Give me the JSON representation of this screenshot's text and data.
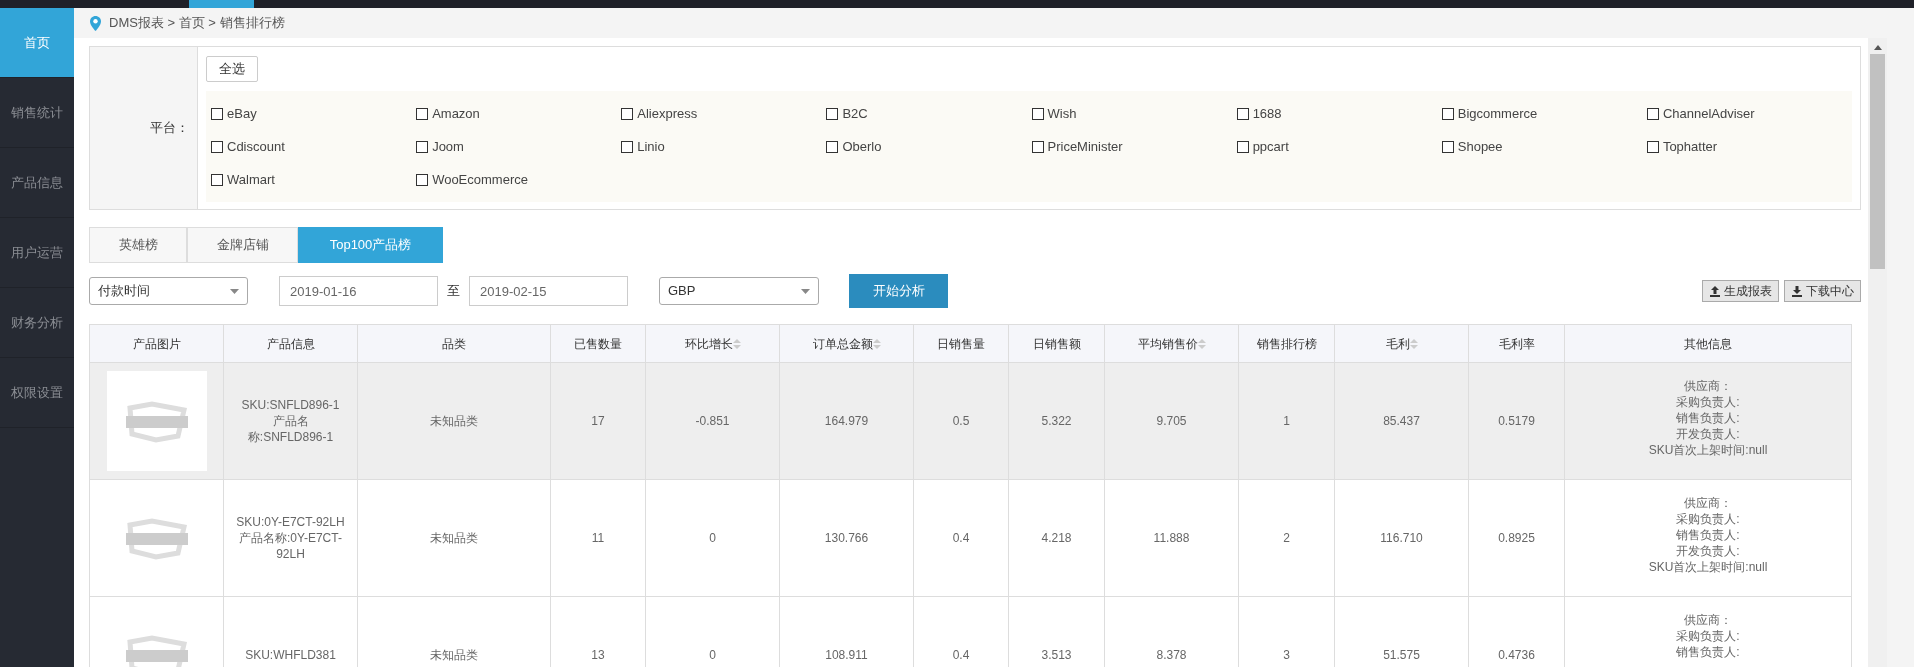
{
  "sidebar": {
    "items": [
      {
        "label": "首页",
        "selected": true
      },
      {
        "label": "销售统计",
        "selected": false
      },
      {
        "label": "产品信息",
        "selected": false
      },
      {
        "label": "用户运营",
        "selected": false
      },
      {
        "label": "财务分析",
        "selected": false
      },
      {
        "label": "权限设置",
        "selected": false
      }
    ]
  },
  "breadcrumb": "DMS报表 > 首页 > 销售排行榜",
  "platform_filter": {
    "label": "平台：",
    "select_all": "全选",
    "platforms": [
      {
        "label": "eBay",
        "checked": false
      },
      {
        "label": "Amazon",
        "checked": false
      },
      {
        "label": "Aliexpress",
        "checked": false
      },
      {
        "label": "B2C",
        "checked": false
      },
      {
        "label": "Wish",
        "checked": false
      },
      {
        "label": "1688",
        "checked": false
      },
      {
        "label": "Bigcommerce",
        "checked": false
      },
      {
        "label": "ChannelAdviser",
        "checked": false
      },
      {
        "label": "Cdiscount",
        "checked": false
      },
      {
        "label": "Joom",
        "checked": false
      },
      {
        "label": "Linio",
        "checked": false
      },
      {
        "label": "Oberlo",
        "checked": false
      },
      {
        "label": "PriceMinister",
        "checked": false
      },
      {
        "label": "ppcart",
        "checked": false
      },
      {
        "label": "Shopee",
        "checked": false
      },
      {
        "label": "Tophatter",
        "checked": false
      },
      {
        "label": "Walmart",
        "checked": false
      },
      {
        "label": "WooEcommerce",
        "checked": false
      }
    ]
  },
  "tabs": [
    {
      "label": "英雄榜",
      "selected": false
    },
    {
      "label": "金牌店铺",
      "selected": false
    },
    {
      "label": "Top100产品榜",
      "selected": true
    }
  ],
  "filters": {
    "time_type": "付款时间",
    "start_date": "2019-01-16",
    "range_separator": "至",
    "end_date": "2019-02-15",
    "currency": "GBP",
    "analyze_button": "开始分析"
  },
  "actions": [
    "生成报表",
    "下载中心"
  ],
  "table": {
    "columns": [
      {
        "label": "产品图片",
        "sortable": false
      },
      {
        "label": "产品信息",
        "sortable": false
      },
      {
        "label": "品类",
        "sortable": false
      },
      {
        "label": "已售数量",
        "sortable": false
      },
      {
        "label": "环比增长",
        "sortable": true
      },
      {
        "label": "订单总金额",
        "sortable": true
      },
      {
        "label": "日销售量",
        "sortable": false
      },
      {
        "label": "日销售额",
        "sortable": false
      },
      {
        "label": "平均销售价",
        "sortable": true
      },
      {
        "label": "销售排行榜",
        "sortable": false
      },
      {
        "label": "毛利",
        "sortable": true
      },
      {
        "label": "毛利率",
        "sortable": false
      },
      {
        "label": "其他信息",
        "sortable": false
      }
    ],
    "rows": [
      {
        "highlighted": true,
        "cells": [
          "",
          [
            "SKU:SNFLD896-1",
            "产品名",
            "称:SNFLD896-1"
          ],
          "未知品类",
          "17",
          "-0.851",
          "164.979",
          "0.5",
          "5.322",
          "9.705",
          "1",
          "85.437",
          "0.5179",
          [
            "供应商：",
            "采购负责人:",
            "销售负责人:",
            "开发负责人:",
            "SKU首次上架时间:null"
          ]
        ]
      },
      {
        "highlighted": false,
        "cells": [
          "",
          [
            "SKU:0Y-E7CT-92LH",
            "产品名称:0Y-E7CT-",
            "92LH"
          ],
          "未知品类",
          "11",
          "0",
          "130.766",
          "0.4",
          "4.218",
          "11.888",
          "2",
          "116.710",
          "0.8925",
          [
            "供应商：",
            "采购负责人:",
            "销售负责人:",
            "开发负责人:",
            "SKU首次上架时间:null"
          ]
        ]
      },
      {
        "highlighted": false,
        "cells": [
          "",
          [
            "SKU:WHFLD381"
          ],
          "未知品类",
          "13",
          "0",
          "108.911",
          "0.4",
          "3.513",
          "8.378",
          "3",
          "51.575",
          "0.4736",
          [
            "供应商：",
            "采购负责人:",
            "销售负责人:"
          ]
        ]
      }
    ]
  }
}
